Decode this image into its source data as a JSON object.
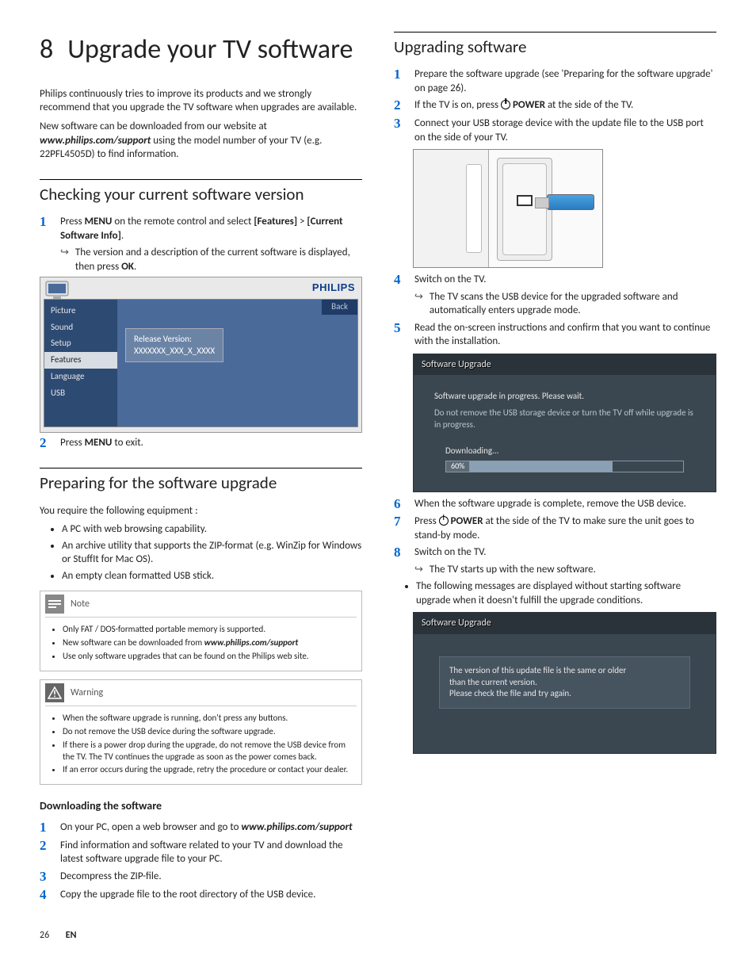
{
  "chapter_num": "8",
  "chapter_title": "Upgrade your TV software",
  "intro_p1": "Philips continuously tries to improve its products and we strongly recommend that you upgrade the TV software when upgrades are available.",
  "intro_p2_a": "New software can be downloaded from our website at ",
  "intro_p2_url": "www.philips.com/support",
  "intro_p2_b": " using the model number of your TV (e.g. 22PFL4505D) to find information.",
  "sec_check_title": "Checking your current software version",
  "check_step1_a": "Press ",
  "check_step1_menu": "MENU",
  "check_step1_b": " on the remote control and select ",
  "check_step1_feat": "[Features]",
  "check_step1_gt": " > ",
  "check_step1_csi": "[Current Software Info]",
  "check_step1_dot": ".",
  "check_step1_sub_a": "The version and a description of the current software is displayed, then press ",
  "check_step1_sub_ok": "OK",
  "check_step1_sub_b": ".",
  "tv_menu": {
    "logo": "PHILIPS",
    "items": [
      "Picture",
      "Sound",
      "Setup",
      "Features",
      "Language",
      "USB"
    ],
    "selected": "Features",
    "back": "Back",
    "tooltip_l1": "Release Version:",
    "tooltip_l2": "XXXXXXX_XXX_X_XXXX"
  },
  "check_step2_a": "Press ",
  "check_step2_menu": "MENU",
  "check_step2_b": " to exit.",
  "sec_prep_title": "Preparing for the software upgrade",
  "prep_intro": "You require the following equipment :",
  "prep_bullets": [
    "A PC with web browsing capability.",
    "An archive utility that supports the ZIP-format (e.g. WinZip for Windows or StuffIt for Mac OS).",
    "An empty clean formatted USB stick."
  ],
  "note_label": "Note",
  "note_bullets_a": "Only FAT / DOS-formatted portable memory is supported.",
  "note_bullets_b_pre": "New software can be downloaded from ",
  "note_bullets_b_url": "www.philips.com/support",
  "note_bullets_c": "Use only software upgrades that can be found on the Philips web site.",
  "warn_label": "Warning",
  "warn_bullets": [
    "When the software upgrade is running, don't press any buttons.",
    "Do not remove the USB device during the software upgrade.",
    "If there is a power drop during the upgrade, do not remove the USB device from the TV. The TV continues the upgrade as soon as the power comes back.",
    "If an error occurs during the upgrade, retry the procedure or contact your dealer."
  ],
  "sec_dl_title": "Downloading the software",
  "dl1_a": "On your PC, open a web browser and go to ",
  "dl1_url": "www.philips.com/support",
  "dl2": "Find information and software related to your TV and download the latest software upgrade file to your PC.",
  "dl3": "Decompress the ZIP-file.",
  "dl4": "Copy the upgrade file to the root directory of the USB device.",
  "sec_upg_title": "Upgrading software",
  "upg1": "Prepare the software upgrade (see 'Preparing for the software upgrade' on page 26).",
  "upg2_a": "If the TV is on, press ",
  "upg2_pow": " POWER",
  "upg2_b": " at the side of the TV.",
  "upg3": "Connect your USB storage device with the update file to the USB port on the side of your TV.",
  "upg4": "Switch on the TV.",
  "upg4_sub": "The TV scans the USB device for the upgraded software and automatically enters upgrade mode.",
  "upg5": "Read the on-screen instructions and confirm that you want to continue with the installation.",
  "sw1": {
    "title": "Software Upgrade",
    "msg1": "Software upgrade in progress. Please wait.",
    "msg2": "Do not remove the USB storage device or turn the TV off while upgrade is in progress.",
    "dl": "Downloading...",
    "pct": "60%"
  },
  "upg6": "When the software upgrade is complete, remove the USB device.",
  "upg7_a": "Press ",
  "upg7_pow": " POWER",
  "upg7_b": " at the side of the TV to make sure the unit goes to stand-by mode.",
  "upg8": "Switch on the TV.",
  "upg8_sub": "The TV starts up with the new software.",
  "upg_bullet": "The following messages are displayed without starting software upgrade when it doesn't fulfill the upgrade conditions.",
  "sw2": {
    "title": "Software Upgrade",
    "l1": "The version of this update file is the same or older",
    "l2": "than the current version.",
    "l3": "Please check the file and try again."
  },
  "footer_page": "26",
  "footer_lang": "EN"
}
